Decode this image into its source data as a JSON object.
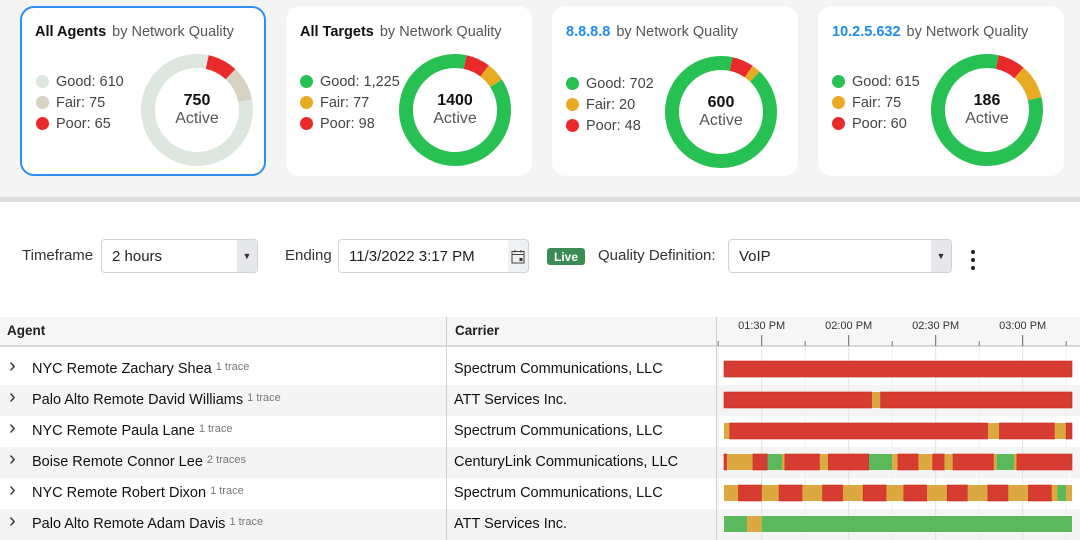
{
  "colors": {
    "good": "#27c052",
    "fair": "#e9ab24",
    "poor": "#e92a2a",
    "agents_good": "#dde7e0",
    "agents_fair": "#d8d2c3",
    "accent": "#2f8ff0",
    "live": "#3b8b54",
    "bar_good": "#5cb85c",
    "bar_fair": "#dca840",
    "bar_poor": "#d63c32"
  },
  "cards": [
    {
      "title": "All Agents",
      "subtitle": "by Network Quality",
      "selected": true,
      "legend": [
        {
          "label": "Good: 610",
          "key": "good",
          "value": 610
        },
        {
          "label": "Fair: 75",
          "key": "fair",
          "value": 75
        },
        {
          "label": "Poor: 65",
          "key": "poor",
          "value": 65
        }
      ],
      "total": "750",
      "total_label": "Active"
    },
    {
      "title": "All Targets",
      "subtitle": "by Network Quality",
      "legend": [
        {
          "label": "Good: 1,225",
          "key": "good",
          "value": 1225
        },
        {
          "label": "Fair: 77",
          "key": "fair",
          "value": 77
        },
        {
          "label": "Poor: 98",
          "key": "poor",
          "value": 98
        }
      ],
      "total": "1400",
      "total_label": "Active"
    },
    {
      "title": "8.8.8.8",
      "subtitle": "by Network Quality",
      "link": true,
      "legend": [
        {
          "label": "Good: 702",
          "key": "good",
          "value": 702
        },
        {
          "label": "Fair: 20",
          "key": "fair",
          "value": 20
        },
        {
          "label": "Poor: 48",
          "key": "poor",
          "value": 48
        }
      ],
      "total": "600",
      "total_label": "Active"
    },
    {
      "title": "10.2.5.632",
      "subtitle": "by Network Quality",
      "link": true,
      "legend": [
        {
          "label": "Good: 615",
          "key": "good",
          "value": 615
        },
        {
          "label": "Fair: 75",
          "key": "fair",
          "value": 75
        },
        {
          "label": "Poor: 60",
          "key": "poor",
          "value": 60
        }
      ],
      "total": "186",
      "total_label": "Active"
    }
  ],
  "controls": {
    "timeframe_label": "Timeframe",
    "timeframe_value": "2 hours",
    "ending_label": "Ending",
    "ending_value": "11/3/2022 3:17 PM",
    "live_badge": "Live",
    "quality_label": "Quality Definition:",
    "quality_value": "VoIP"
  },
  "table": {
    "columns": [
      "Agent",
      "Carrier"
    ],
    "timeline": {
      "start": "13:17",
      "end": "15:17",
      "tick_labels": [
        {
          "time": "13:30",
          "label": "01:30 PM"
        },
        {
          "time": "14:00",
          "label": "02:00 PM"
        },
        {
          "time": "14:30",
          "label": "02:30 PM"
        },
        {
          "time": "15:00",
          "label": "03:00 PM"
        }
      ],
      "minor_ticks": [
        "13:15",
        "13:45",
        "14:15",
        "14:45",
        "15:15"
      ]
    },
    "rows": [
      {
        "agent": "NYC Remote Zachary Shea",
        "traces": "1 trace",
        "carrier": "Spectrum Communications, LLC",
        "segments": [
          [
            "poor",
            "13:17",
            "15:17"
          ]
        ]
      },
      {
        "agent": "Palo Alto Remote David Williams",
        "traces": "1 trace",
        "carrier": "ATT Services Inc.",
        "segments": [
          [
            "poor",
            "13:17",
            "14:08"
          ],
          [
            "fair",
            "14:08",
            "14:11"
          ],
          [
            "poor",
            "14:11",
            "15:17"
          ]
        ]
      },
      {
        "agent": "NYC Remote Paula Lane",
        "traces": "1 trace",
        "carrier": "Spectrum Communications, LLC",
        "segments": [
          [
            "fair",
            "13:17",
            "13:19"
          ],
          [
            "poor",
            "13:19",
            "14:48"
          ],
          [
            "fair",
            "14:48",
            "14:52"
          ],
          [
            "poor",
            "14:52",
            "15:11"
          ],
          [
            "fair",
            "15:11",
            "15:15"
          ],
          [
            "poor",
            "15:15",
            "15:17"
          ]
        ]
      },
      {
        "agent": "Boise Remote Connor Lee",
        "traces": "2 traces",
        "carrier": "CenturyLink Communications, LLC",
        "segments": [
          [
            "poor",
            "13:17",
            "13:18"
          ],
          [
            "fair",
            "13:18",
            "13:27"
          ],
          [
            "poor",
            "13:27",
            "13:32"
          ],
          [
            "good",
            "13:32",
            "13:37"
          ],
          [
            "fair",
            "13:37",
            "13:38"
          ],
          [
            "poor",
            "13:38",
            "13:50"
          ],
          [
            "fair",
            "13:50",
            "13:53"
          ],
          [
            "poor",
            "13:53",
            "14:07"
          ],
          [
            "good",
            "14:07",
            "14:15"
          ],
          [
            "fair",
            "14:15",
            "14:17"
          ],
          [
            "poor",
            "14:17",
            "14:24"
          ],
          [
            "fair",
            "14:24",
            "14:29"
          ],
          [
            "poor",
            "14:29",
            "14:33"
          ],
          [
            "fair",
            "14:33",
            "14:36"
          ],
          [
            "poor",
            "14:36",
            "14:50"
          ],
          [
            "fair",
            "14:50",
            "14:51"
          ],
          [
            "good",
            "14:51",
            "14:57"
          ],
          [
            "fair",
            "14:57",
            "14:58"
          ],
          [
            "poor",
            "14:58",
            "15:17"
          ]
        ]
      },
      {
        "agent": "NYC Remote Robert Dixon",
        "traces": "1 trace",
        "carrier": "Spectrum Communications, LLC",
        "segments": [
          [
            "fair",
            "13:17",
            "13:22"
          ],
          [
            "poor",
            "13:22",
            "13:30"
          ],
          [
            "fair",
            "13:30",
            "13:36"
          ],
          [
            "poor",
            "13:36",
            "13:44"
          ],
          [
            "fair",
            "13:44",
            "13:51"
          ],
          [
            "poor",
            "13:51",
            "13:58"
          ],
          [
            "fair",
            "13:58",
            "14:05"
          ],
          [
            "poor",
            "14:05",
            "14:13"
          ],
          [
            "fair",
            "14:13",
            "14:19"
          ],
          [
            "poor",
            "14:19",
            "14:27"
          ],
          [
            "fair",
            "14:27",
            "14:34"
          ],
          [
            "poor",
            "14:34",
            "14:41"
          ],
          [
            "fair",
            "14:41",
            "14:48"
          ],
          [
            "poor",
            "14:48",
            "14:55"
          ],
          [
            "fair",
            "14:55",
            "15:02"
          ],
          [
            "poor",
            "15:02",
            "15:10"
          ],
          [
            "fair",
            "15:10",
            "15:12"
          ],
          [
            "good",
            "15:12",
            "15:15"
          ],
          [
            "fair",
            "15:15",
            "15:17"
          ]
        ]
      },
      {
        "agent": "Palo Alto Remote Adam Davis",
        "traces": "1 trace",
        "carrier": "ATT Services Inc.",
        "segments": [
          [
            "good",
            "13:17",
            "13:25"
          ],
          [
            "fair",
            "13:25",
            "13:30"
          ],
          [
            "good",
            "13:30",
            "15:17"
          ]
        ]
      }
    ]
  }
}
